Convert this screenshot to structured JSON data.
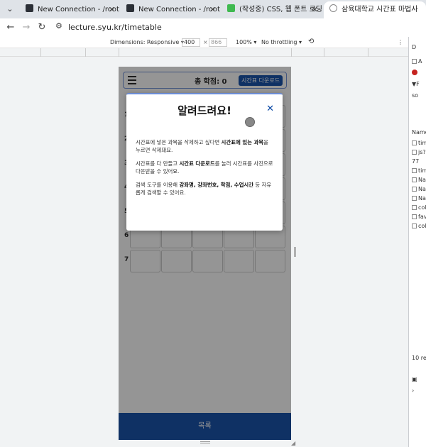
{
  "browser": {
    "tabs": [
      {
        "title": "New Connection - /root/lecture",
        "favicon": "terminal-icon",
        "active": false
      },
      {
        "title": "New Connection - /root/lecture",
        "favicon": "terminal-icon",
        "active": false
      },
      {
        "title": "(작성중) CSS, 웹 폰트 로딩 속도",
        "favicon": "velog-icon",
        "active": false
      },
      {
        "title": "삼육대학교 시간표 마법사",
        "favicon": "globe-icon",
        "active": true
      }
    ],
    "url": "lecture.syu.kr/timetable"
  },
  "device_toolbar": {
    "dimensions_label": "Dimensions: Responsive",
    "width": "400",
    "height": "866",
    "zoom": "100%",
    "throttling": "No throttling"
  },
  "devtools": {
    "items": [
      "D",
      "A",
      "F",
      "so",
      "Name",
      "tim",
      "js?",
      "77",
      "tim",
      "Na",
      "Na",
      "Na",
      "col",
      "fav",
      "col",
      "10 re"
    ]
  },
  "app": {
    "total_credits": "총 학점: 0",
    "download_label": "시간표 다운로드",
    "row_numbers": [
      "1",
      "2",
      "3",
      "4",
      "5",
      "6",
      "7"
    ],
    "footer_label": "목록",
    "accent": "#0c4aa6"
  },
  "modal": {
    "title": "알려드려요!",
    "close_symbol": "✕",
    "paragraphs": [
      {
        "before": "시간표에 넣은 과목을 삭제하고 싶다면 ",
        "bold": "시간표에 있는 과목",
        "after": "을 누르면 삭제돼요."
      },
      {
        "before": "시간표를 다 만들고 ",
        "bold": "시간표 다운로드",
        "after": "를 눌러 시간표를 사진으로 다운받을 수 있어요."
      },
      {
        "before": "검색 도구를 이용해 ",
        "bold": "강좌명, 강좌번호, 학점, 수업시간",
        "after": " 등 자유롭게 검색할 수 있어요."
      }
    ]
  }
}
